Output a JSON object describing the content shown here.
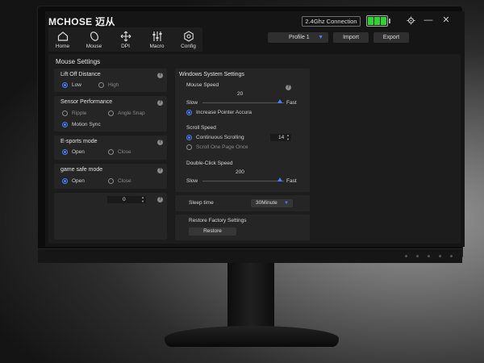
{
  "titlebar": {
    "brand": "MCHOSE 迈从",
    "connection": "2.4Ghz Connection"
  },
  "nav": [
    {
      "label": "Home",
      "icon": "home-icon"
    },
    {
      "label": "Mouse",
      "icon": "mouse-icon"
    },
    {
      "label": "DPI",
      "icon": "dpi-icon"
    },
    {
      "label": "Macro",
      "icon": "macro-icon"
    },
    {
      "label": "Config",
      "icon": "config-icon"
    }
  ],
  "profile": {
    "selected": "Profile  1",
    "import_label": "Import",
    "export_label": "Export"
  },
  "panel_title": "Mouse Settings",
  "lift_off": {
    "title": "Lift Off Distance",
    "options": [
      "Low",
      "High"
    ],
    "selected": "Low"
  },
  "sensor": {
    "title": "Sensor Performance",
    "options": [
      "Ripple",
      "Angle Snap",
      "Motion Sync"
    ],
    "selected": "Motion Sync"
  },
  "esports": {
    "title": "E-sports mode",
    "options": [
      "Open",
      "Close"
    ],
    "selected": "Open"
  },
  "game_safe": {
    "title": "game safe mode",
    "options": [
      "Open",
      "Close"
    ],
    "selected": "Open"
  },
  "extra": {
    "value": "0"
  },
  "windows": {
    "title": "Windows System Settings",
    "mouse_speed": {
      "label": "Mouse Speed",
      "value": "20",
      "slow": "Slow",
      "fast": "Fast",
      "level": 0.95,
      "accel_label": "Increase Pointer Accura"
    },
    "scroll_speed": {
      "label": "Scroll Speed",
      "continuous": "Continuous Scrolling",
      "lines": "14",
      "one_page": "Scroll One Page Once"
    },
    "dbl_click": {
      "label": "Double-Click Speed",
      "value": "200",
      "slow": "Slow",
      "fast": "Fast",
      "level": 0.95
    }
  },
  "sleep": {
    "label": "Sleep time",
    "value": "30Minute"
  },
  "restore": {
    "title": "Restore Factory Settings",
    "button": "Restore"
  },
  "colors": {
    "accent": "#4c7dff",
    "battery": "#2fd42f",
    "background": "#151515"
  }
}
